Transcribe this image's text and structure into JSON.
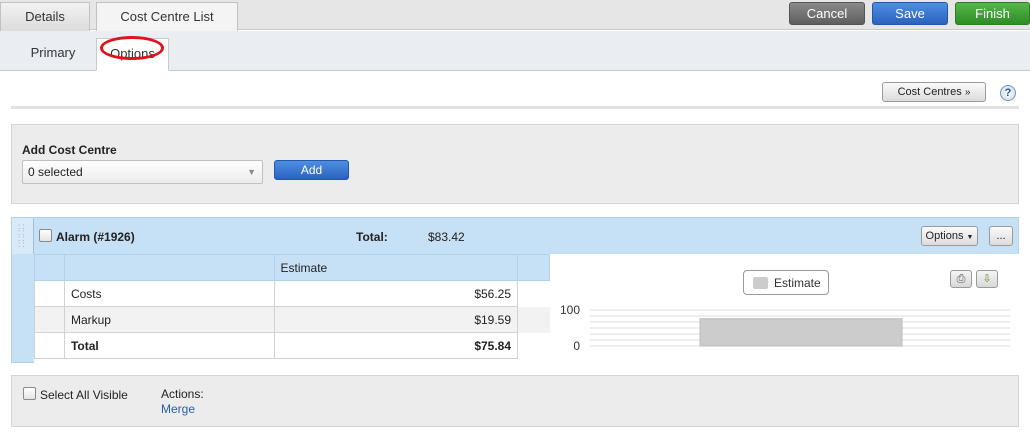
{
  "top_tabs": [
    {
      "label": "Details"
    },
    {
      "label": "Cost Centre List"
    }
  ],
  "actions": {
    "cancel": "Cancel",
    "save": "Save",
    "finish": "Finish"
  },
  "sub_tabs": [
    {
      "label": "Primary"
    },
    {
      "label": "Options"
    }
  ],
  "toolbar": {
    "cost_centres_label": "Cost Centres",
    "help_label": "?"
  },
  "add_cost_centre": {
    "heading": "Add Cost Centre",
    "selected_value": "0 selected",
    "add_label": "Add"
  },
  "group": {
    "name": "Alarm (#1926)",
    "total_label": "Total:",
    "total_value": "$83.42",
    "options_label": "Options",
    "more_label": "..."
  },
  "table": {
    "column_header": "Estimate",
    "rows": [
      {
        "label": "Costs",
        "value": "$56.25"
      },
      {
        "label": "Markup",
        "value": "$19.59"
      },
      {
        "label": "Total",
        "value": "$75.84"
      }
    ]
  },
  "chart_data": {
    "type": "bar",
    "categories": [
      ""
    ],
    "series": [
      {
        "name": "Estimate",
        "values": [
          75.84
        ]
      }
    ],
    "ytick_labels": [
      "100",
      "0"
    ],
    "ylim": [
      0,
      100
    ],
    "legend_position": "top",
    "colors": {
      "Estimate": "#cccccc"
    }
  },
  "footer": {
    "select_all_label": "Select All Visible",
    "actions_label": "Actions:",
    "merge_label": "Merge"
  },
  "colors": {
    "accent_blue": "#2a63bf",
    "finish_green": "#2f8c27",
    "highlight_red": "#e0121a",
    "group_bg": "#c6e0f5"
  }
}
